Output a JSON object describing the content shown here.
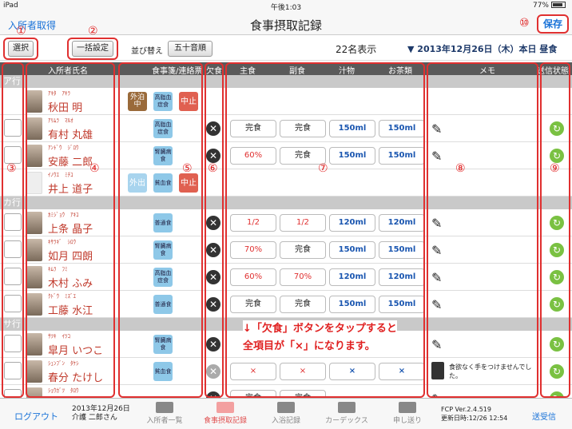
{
  "status_bar": {
    "device": "iPad",
    "time": "午後1:03",
    "battery": "77%"
  },
  "nav": {
    "left_link": "入所者取得",
    "title": "食事摂取記録",
    "save_button": "保存"
  },
  "annotation_markers": [
    "①",
    "②",
    "③",
    "④",
    "⑤",
    "⑥",
    "⑦",
    "⑧",
    "⑨",
    "⑩"
  ],
  "toolbar": {
    "select_button": "選択",
    "bulk_button": "一括設定",
    "sort_label": "並び替え",
    "sort_button": "五十音順",
    "count": "22名表示",
    "date": "▼ 2013年12月26日（木）本日 昼食"
  },
  "columns": {
    "name": "入所者氏名",
    "diet": "食事箋/連絡票",
    "absent": "欠食",
    "main": "主食",
    "side": "副食",
    "soup": "汁物",
    "tea": "お茶類",
    "memo": "メモ",
    "sync": "送信状態"
  },
  "sections": {
    "a": "ア行",
    "ka": "カ行",
    "sa": "サ行"
  },
  "rows": [
    {
      "kana": "ｱｷﾀ　ｱｷﾗ",
      "name": "秋田 明",
      "tags": [
        {
          "text": "外泊\n中",
          "color": "brown"
        },
        {
          "text": "高脂血\n症食",
          "color": "blue"
        },
        {
          "text": "中止",
          "color": "red"
        }
      ],
      "main": "",
      "side": "",
      "soup": "",
      "tea": ""
    },
    {
      "kana": "ｱﾘﾑﾗ　ﾏﾙｵ",
      "name": "有村 丸雄",
      "tags": [
        {
          "text": "高脂血\n症食",
          "color": "blue"
        }
      ],
      "main": "完食",
      "side": "完食",
      "soup": "150ml",
      "tea": "150ml"
    },
    {
      "kana": "ｱﾝﾄﾞｳ　ｼﾞﾛｳ",
      "name": "安藤 二郎",
      "tags": [
        {
          "text": "腎臓病\n食",
          "color": "blue"
        }
      ],
      "main": "60%",
      "side": "完食",
      "soup": "150ml",
      "tea": "150ml"
    },
    {
      "kana": "ｲﾉｳｴ　ﾐﾁｺ",
      "name": "井上 道子",
      "tags": [
        {
          "text": "外出",
          "color": "lblue"
        },
        {
          "text": "貧血食",
          "color": "blue"
        },
        {
          "text": "中止",
          "color": "red"
        }
      ],
      "main": "",
      "side": "",
      "soup": "",
      "tea": ""
    },
    {
      "kana": "ｶﾐｼﾞｮｳ　ｱｷｺ",
      "name": "上条 晶子",
      "tags": [
        {
          "text": "普通食",
          "color": "blue"
        }
      ],
      "main": "1/2",
      "side": "1/2",
      "soup": "120ml",
      "tea": "120ml"
    },
    {
      "kana": "ｷｻﾗｷﾞ　ｼﾛｳ",
      "name": "如月 四朗",
      "tags": [
        {
          "text": "腎臓病\n食",
          "color": "blue"
        }
      ],
      "main": "70%",
      "side": "完食",
      "soup": "150ml",
      "tea": "150ml"
    },
    {
      "kana": "ｷﾑﾗ　ﾌﾐ",
      "name": "木村 ふみ",
      "tags": [
        {
          "text": "高脂血\n症食",
          "color": "blue"
        }
      ],
      "main": "60%",
      "side": "70%",
      "soup": "120ml",
      "tea": "120ml"
    },
    {
      "kana": "ｸﾄﾞｳ　ﾐｽﾞｴ",
      "name": "工藤 水江",
      "tags": [
        {
          "text": "普通食",
          "color": "blue"
        }
      ],
      "main": "完食",
      "side": "完食",
      "soup": "150ml",
      "tea": "150ml"
    },
    {
      "kana": "ｻﾂｷ　ｲﾂｺ",
      "name": "皐月 いつこ",
      "tags": [
        {
          "text": "腎臓病\n食",
          "color": "blue"
        }
      ],
      "main": "",
      "side": "",
      "soup": "",
      "tea": ""
    },
    {
      "kana": "ｼｭﾝﾌﾞﾝ　ﾀｹｼ",
      "name": "春分 たけし",
      "tags": [
        {
          "text": "貧血食",
          "color": "blue"
        }
      ],
      "main": "×",
      "side": "×",
      "soup": "×",
      "tea": "×",
      "memo": "食欲なく手をつけませんでした。"
    },
    {
      "kana": "ｼｮｳｶﾞﾂ　ﾀﾛｳ",
      "name": "",
      "tags": [],
      "main": "完食",
      "side": "完食",
      "soup": "",
      "tea": ""
    }
  ],
  "annotation_text": {
    "line1": "↓「欠食」ボタンをタップすると",
    "line2": "全項目が「×」になります。"
  },
  "tabbar": {
    "logout": "ログアウト",
    "date_line": "2013年12月26日",
    "user_line": "介護 二郎さん",
    "tab1": "入所者一覧",
    "tab2": "食事摂取記録",
    "tab3": "入浴記録",
    "tab4": "カーデックス",
    "tab5": "申し送り",
    "version": "FCP Ver.2.4.519",
    "updated": "更新日時:12/26 12:54",
    "sync": "送受信"
  }
}
